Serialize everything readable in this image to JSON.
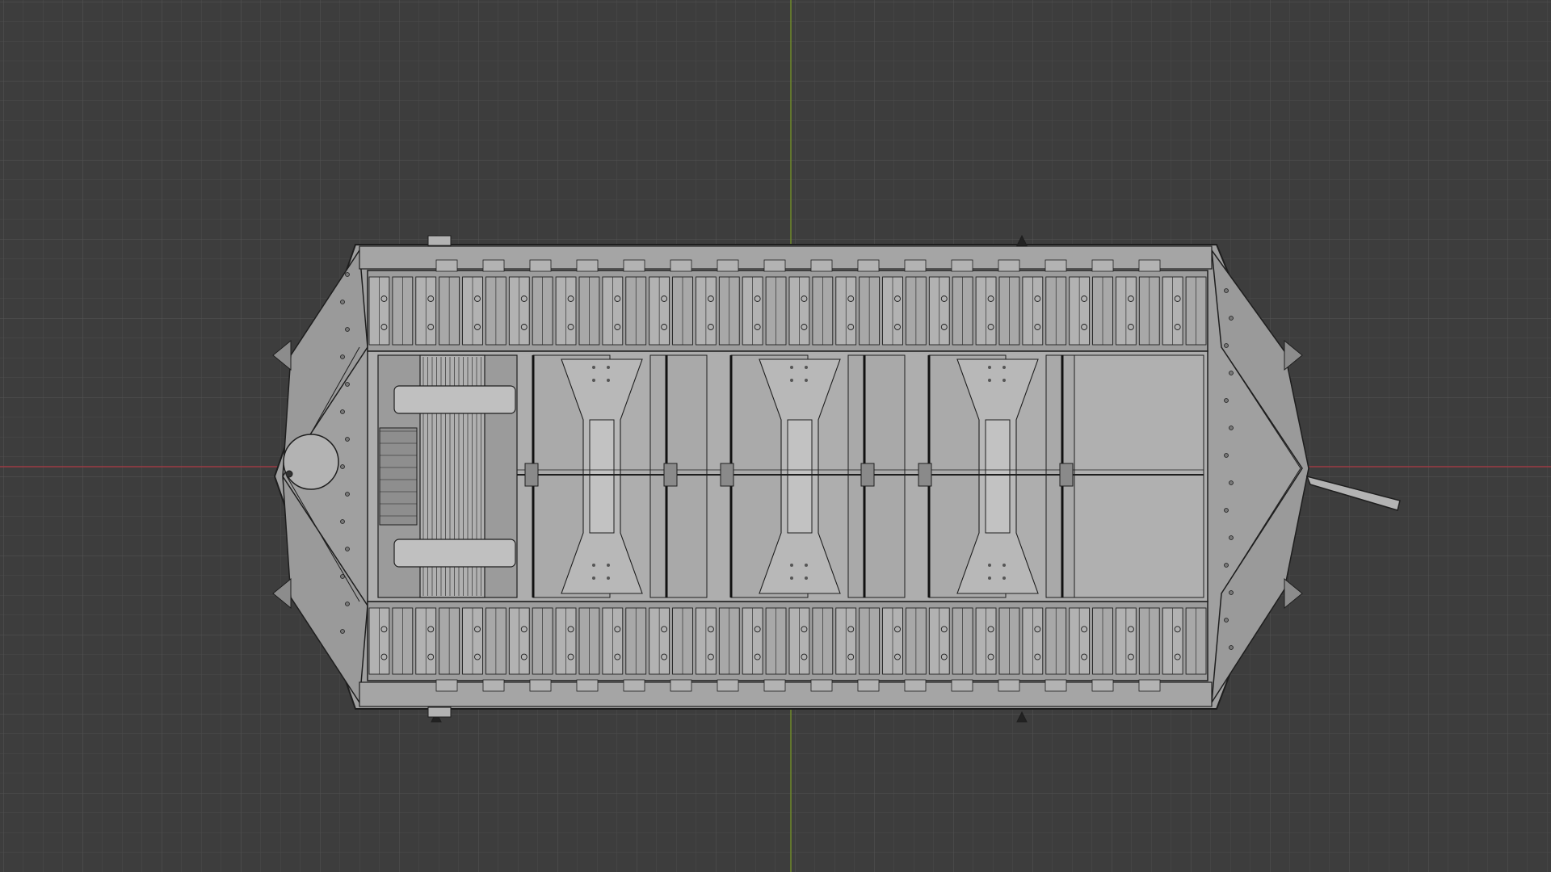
{
  "viewport": {
    "view": "top-orthographic",
    "shading": "wireframe-solid",
    "colors": {
      "background": "#3d3d3d",
      "grid_minor": "#4a4a4a",
      "grid_major": "#555555",
      "x_axis": "#9b3b45",
      "y_axis": "#6f8a2a",
      "mesh_fill": "#a0a0a0",
      "mesh_fill_light": "#b3b3b3",
      "mesh_line": "#1e1e1e"
    }
  },
  "model": {
    "object": "tank-hull",
    "track_link_count": 36,
    "deck_panel_count": 3,
    "has_gun_barrel": true
  }
}
